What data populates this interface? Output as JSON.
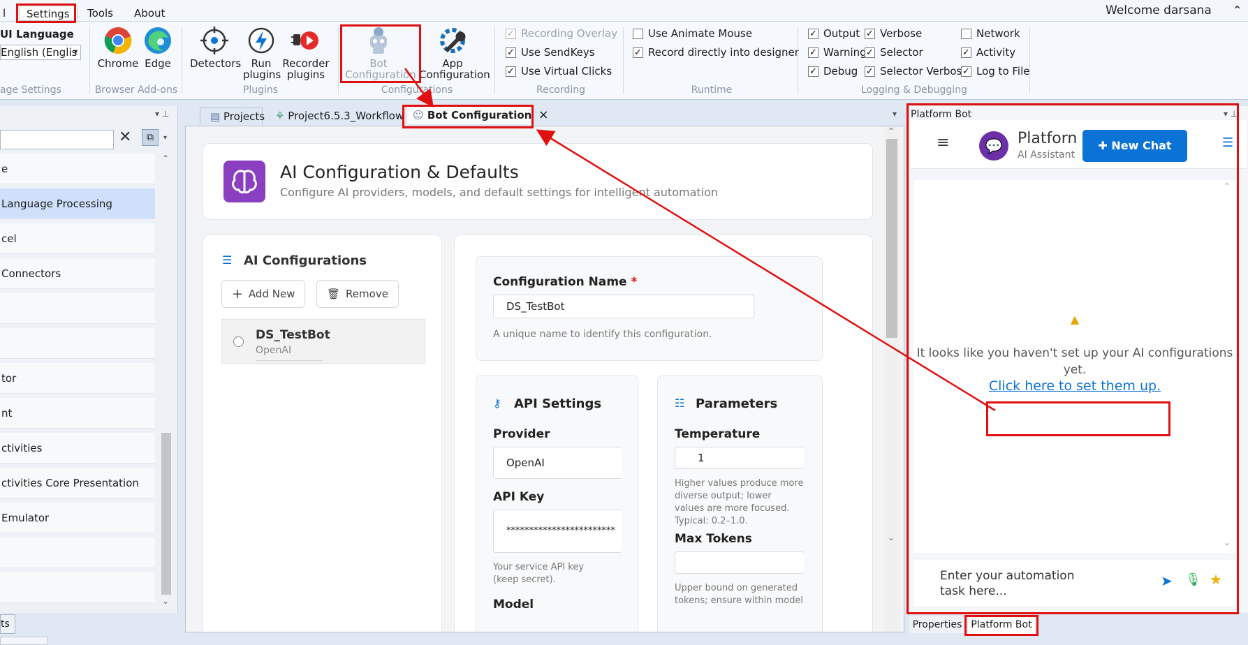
{
  "menu": {
    "partial": "l",
    "settings": "Settings",
    "tools": "Tools",
    "about": "About",
    "welcome": "Welcome  darsana",
    "chevron": "⌃"
  },
  "ribbon": {
    "ui_language_label": "UI Language",
    "ui_language_value": "English (Englis",
    "language_group": "age Settings",
    "chrome": "Chrome",
    "edge": "Edge",
    "browser_group": "Browser Add-ons",
    "detectors": "Detectors",
    "run_plugins": "Run\nplugins",
    "recorder_plugins": "Recorder\nplugins",
    "plugins_group": "Plugins",
    "bot_configuration": "Bot\nConfiguration",
    "app_configuration": "App\nConfiguration",
    "configurations_group": "Configurations",
    "recording_overlay": "Recording Overlay",
    "use_sendkeys": "Use SendKeys",
    "use_virtual_clicks": "Use Virtual Clicks",
    "recording_group": "Recording",
    "use_animate_mouse": "Use Animate Mouse",
    "record_directly": "Record directly into designer",
    "runtime_group": "Runtime",
    "output": "Output",
    "warning": "Warning",
    "debug": "Debug",
    "verbose": "Verbose",
    "selector": "Selector",
    "selector_verbose": "Selector Verbose",
    "network": "Network",
    "activity": "Activity",
    "log_to_file": "Log to File",
    "logging_group": "Logging & Debugging"
  },
  "left_panel": {
    "items": [
      "e",
      "Language Processing",
      "cel",
      "Connectors",
      "",
      "",
      "tor",
      "nt",
      "ctivities",
      "ctivities Core Presentation",
      "Emulator",
      "",
      ""
    ],
    "bottom_tab": "ts"
  },
  "tabs": {
    "projects": "Projects",
    "workflow": "Project6.5.3_Workflow",
    "bot_config": "Bot Configuration",
    "close": "×",
    "platform_bot": "Platform Bot"
  },
  "header": {
    "title": "AI Configuration & Defaults",
    "subtitle": "Configure AI providers, models, and default settings for intelligent automation"
  },
  "configs": {
    "title": "AI Configurations",
    "add_new": "Add New",
    "remove": "Remove",
    "items": [
      {
        "name": "DS_TestBot",
        "provider": "OpenAI"
      }
    ]
  },
  "form": {
    "config_name_label": "Configuration Name",
    "required_mark": "*",
    "config_name_value": "DS_TestBot",
    "config_name_help": "A unique name to identify this configuration.",
    "api_settings_title": "API Settings",
    "provider_label": "Provider",
    "provider_value": "OpenAI",
    "api_key_label": "API Key",
    "api_key_value": "************************",
    "api_key_help": "Your service API key (keep secret).",
    "model_label": "Model",
    "parameters_title": "Parameters",
    "temperature_label": "Temperature",
    "temperature_value": "1",
    "temperature_help": "Higher values produce more diverse output;  lower values are more focused. Typical: 0.2–1.0.",
    "max_tokens_label": "Max Tokens",
    "max_tokens_help": "Upper bound on generated tokens; ensure within model"
  },
  "bot": {
    "panel_title": "Platform Bot",
    "name": "Platforn",
    "tagline": "AI Assistant",
    "new_chat": "New Chat",
    "warning_text_1": "It looks like you haven't set up your AI configurations",
    "warning_text_2": "yet.",
    "setup_link": "Click here to set them up.",
    "input_placeholder": "Enter your automation task here...",
    "bottom_tab_properties": "Properties",
    "bottom_tab_bot": "Platform Bot"
  },
  "colors": {
    "accent": "#0b72d6",
    "brand_purple": "#8a3fc0",
    "annotation_red": "#e01010"
  }
}
